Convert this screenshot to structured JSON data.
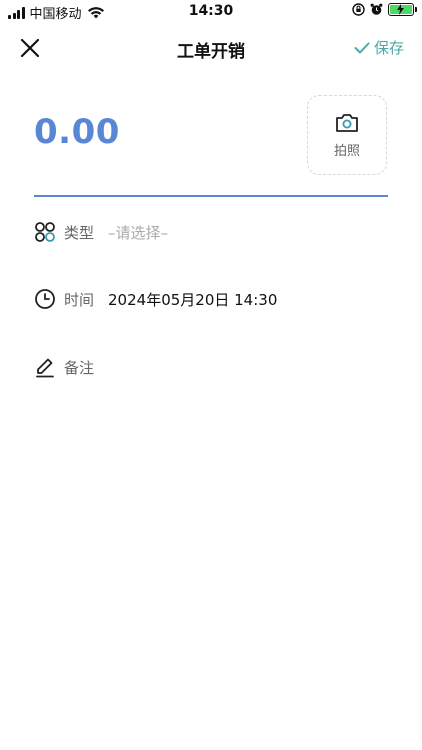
{
  "status_bar": {
    "carrier": "中国移动",
    "time": "14:30",
    "icons": [
      "signal-icon",
      "wifi-icon",
      "orientation-lock-icon",
      "alarm-icon",
      "battery-charging-icon"
    ],
    "battery_color": "#4cd964"
  },
  "nav": {
    "close_icon": "close-icon",
    "title": "工单开销",
    "save_label": "保存",
    "accent_color": "#4aa8a8"
  },
  "amount": {
    "value": "0.00",
    "color": "#5a86d6"
  },
  "photo": {
    "label": "拍照",
    "icon": "camera-icon"
  },
  "form": {
    "type": {
      "icon": "category-icon",
      "label": "类型",
      "placeholder": "–请选择–"
    },
    "time": {
      "icon": "clock-icon",
      "label": "时间",
      "value": "2024年05月20日 14:30"
    },
    "note": {
      "icon": "pencil-icon",
      "label": "备注"
    }
  }
}
